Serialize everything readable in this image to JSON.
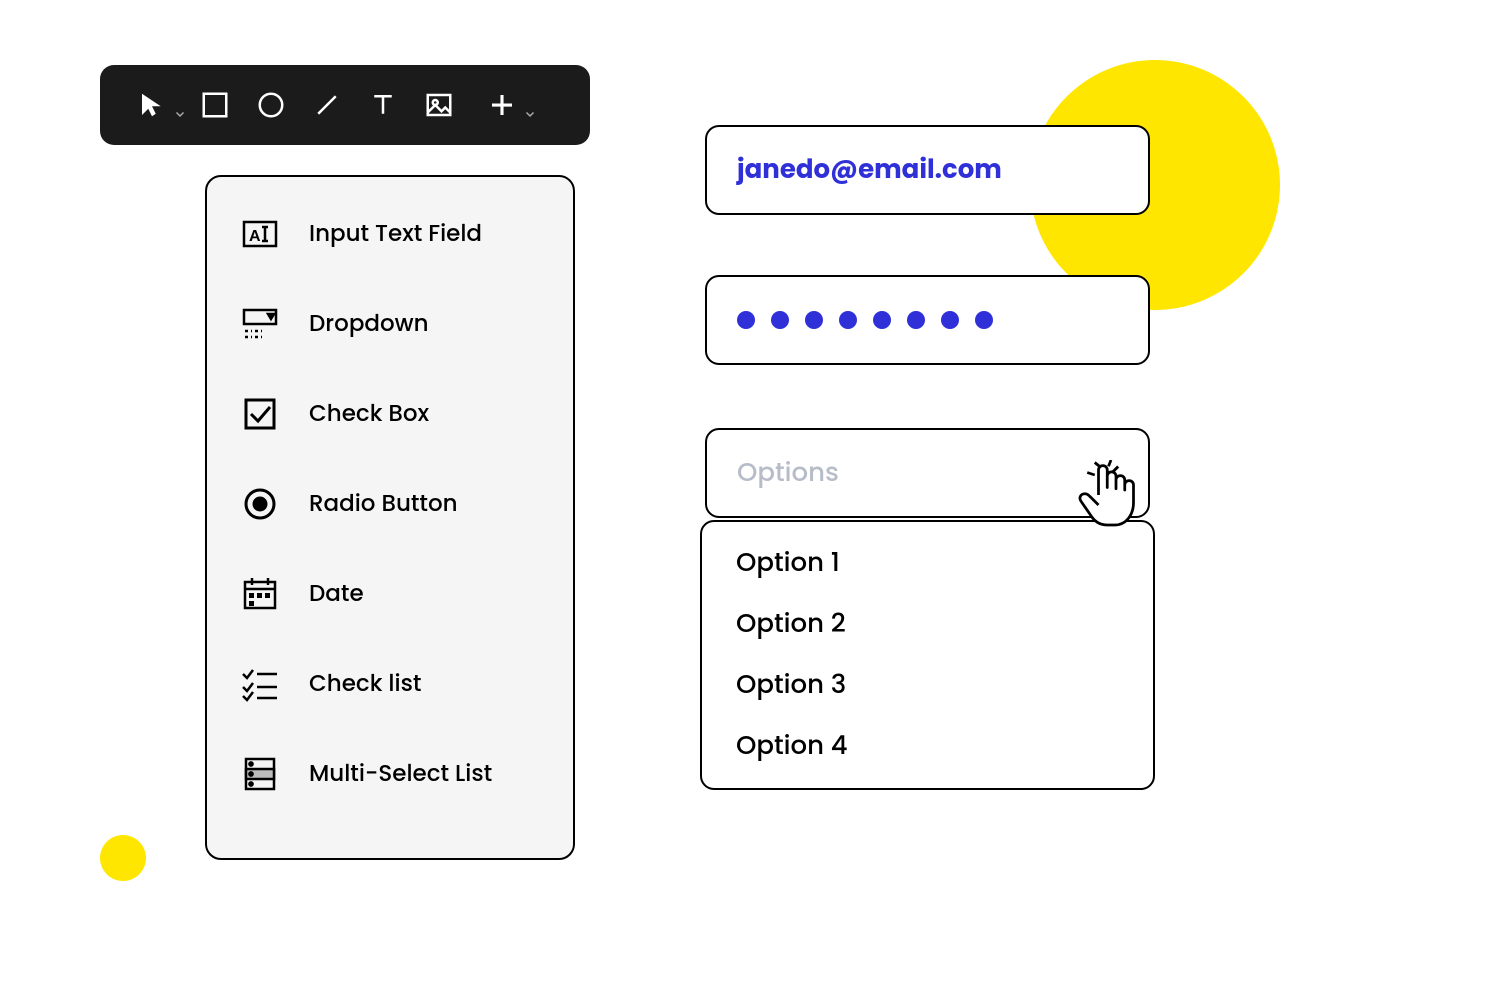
{
  "toolbar": {
    "tools": [
      {
        "name": "pointer",
        "chevron": true
      },
      {
        "name": "rectangle",
        "chevron": false
      },
      {
        "name": "circle",
        "chevron": false
      },
      {
        "name": "line",
        "chevron": false
      },
      {
        "name": "text",
        "chevron": false
      },
      {
        "name": "image",
        "chevron": false
      },
      {
        "name": "plus",
        "chevron": true
      }
    ]
  },
  "panel": {
    "items": [
      {
        "icon": "input-text-field-icon",
        "label": "Input Text Field"
      },
      {
        "icon": "dropdown-icon",
        "label": "Dropdown"
      },
      {
        "icon": "checkbox-icon",
        "label": "Check Box"
      },
      {
        "icon": "radio-button-icon",
        "label": "Radio Button"
      },
      {
        "icon": "date-icon",
        "label": "Date"
      },
      {
        "icon": "checklist-icon",
        "label": "Check list"
      },
      {
        "icon": "multiselect-icon",
        "label": "Multi-Select List"
      }
    ]
  },
  "form": {
    "email": {
      "value": "janedo@email.com"
    },
    "password": {
      "dot_count": 8
    },
    "select": {
      "placeholder": "Options",
      "options": [
        "Option 1",
        "Option 2",
        "Option 3",
        "Option 4"
      ]
    }
  },
  "colors": {
    "accent": "#3030d8",
    "highlight": "#ffe600"
  }
}
